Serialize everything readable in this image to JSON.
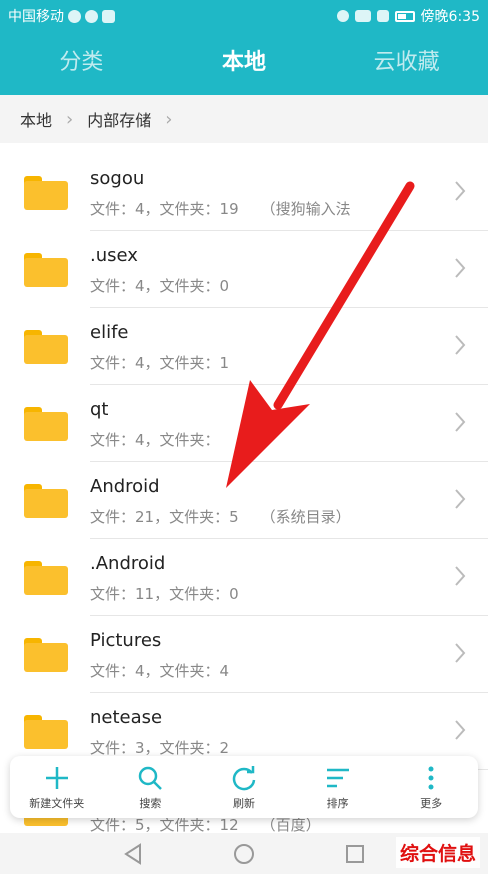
{
  "status_bar": {
    "carrier": "中国移动",
    "time": "傍晚6:35"
  },
  "tabs": [
    {
      "label": "分类",
      "active": false
    },
    {
      "label": "本地",
      "active": true
    },
    {
      "label": "云收藏",
      "active": false
    }
  ],
  "breadcrumb": [
    "本地",
    "内部存储"
  ],
  "files": [
    {
      "name": "sogou",
      "meta": "文件：4，文件夹：19",
      "tag": "（搜狗输入法"
    },
    {
      "name": ".usex",
      "meta": "文件：4，文件夹：0",
      "tag": ""
    },
    {
      "name": "elife",
      "meta": "文件：4，文件夹：1",
      "tag": ""
    },
    {
      "name": "qt",
      "meta": "文件：4，文件夹：",
      "tag": ""
    },
    {
      "name": "Android",
      "meta": "文件：21，文件夹：5",
      "tag": "（系统目录）"
    },
    {
      "name": ".Android",
      "meta": "文件：11，文件夹：0",
      "tag": ""
    },
    {
      "name": "Pictures",
      "meta": "文件：4，文件夹：4",
      "tag": ""
    },
    {
      "name": "netease",
      "meta": "文件：3，文件夹：2",
      "tag": ""
    },
    {
      "name": "",
      "meta": "文件：5，文件夹：12",
      "tag": "（百度）"
    }
  ],
  "toolbar": [
    {
      "label": "新建文件夹",
      "icon": "plus-icon"
    },
    {
      "label": "搜索",
      "icon": "search-icon"
    },
    {
      "label": "刷新",
      "icon": "refresh-icon"
    },
    {
      "label": "排序",
      "icon": "sort-icon"
    },
    {
      "label": "更多",
      "icon": "more-icon"
    }
  ],
  "watermark": "综合信息",
  "colors": {
    "header": "#1fb8c6",
    "accent": "#1fb8c6",
    "folder": "#fbc02d",
    "arrow": "#e81c1c"
  }
}
